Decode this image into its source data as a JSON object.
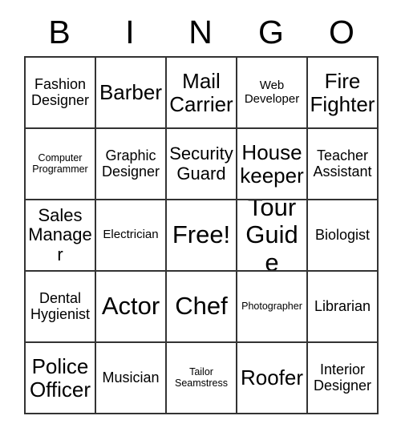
{
  "card": {
    "header": {
      "letters": [
        "B",
        "I",
        "N",
        "G",
        "O"
      ]
    },
    "grid": {
      "rows": 5,
      "columns": 5,
      "border_color": "#333333",
      "background_color": "#ffffff",
      "text_color": "#000000",
      "cells": [
        [
          {
            "text": "Fashion Designer",
            "size": "m",
            "free": false
          },
          {
            "text": "Barber",
            "size": "xl",
            "free": false
          },
          {
            "text": "Mail Carrier",
            "size": "xl",
            "free": false
          },
          {
            "text": "Web Developer",
            "size": "s",
            "free": false
          },
          {
            "text": "Fire Fighter",
            "size": "xl",
            "free": false
          }
        ],
        [
          {
            "text": "Computer Programmer",
            "size": "xs",
            "free": false
          },
          {
            "text": "Graphic Designer",
            "size": "m",
            "free": false
          },
          {
            "text": "Security Guard",
            "size": "l",
            "free": false
          },
          {
            "text": "House keeper",
            "size": "xl",
            "free": false
          },
          {
            "text": "Teacher Assistant",
            "size": "m",
            "free": false
          }
        ],
        [
          {
            "text": "Sales Manager",
            "size": "l",
            "free": false
          },
          {
            "text": "Electrician",
            "size": "s",
            "free": false
          },
          {
            "text": "Free!",
            "size": "xxl",
            "free": true
          },
          {
            "text": "Tour Guide",
            "size": "xxl",
            "free": false
          },
          {
            "text": "Biologist",
            "size": "m",
            "free": false
          }
        ],
        [
          {
            "text": "Dental Hygienist",
            "size": "m",
            "free": false
          },
          {
            "text": "Actor",
            "size": "xxl",
            "free": false
          },
          {
            "text": "Chef",
            "size": "xxl",
            "free": false
          },
          {
            "text": "Photographer",
            "size": "xs",
            "free": false
          },
          {
            "text": "Librarian",
            "size": "m",
            "free": false
          }
        ],
        [
          {
            "text": "Police Officer",
            "size": "xl",
            "free": false
          },
          {
            "text": "Musician",
            "size": "m",
            "free": false
          },
          {
            "text": "Tailor Seamstress",
            "size": "xs",
            "free": false
          },
          {
            "text": "Roofer",
            "size": "xl",
            "free": false
          },
          {
            "text": "Interior Designer",
            "size": "m",
            "free": false
          }
        ]
      ]
    }
  }
}
